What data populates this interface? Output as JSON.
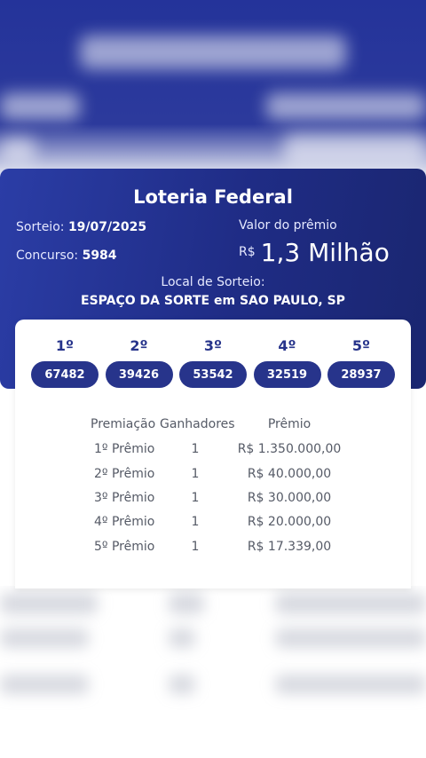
{
  "card": {
    "title": "Loteria Federal",
    "sorteio_label": "Sorteio:",
    "sorteio_date": "19/07/2025",
    "concurso_label": "Concurso:",
    "concurso_number": "5984",
    "prize_label": "Valor do prêmio",
    "prize_currency": "R$",
    "prize_amount": "1,3 Milhão",
    "local_label": "Local de Sorteio:",
    "local_value": "ESPAÇO DA SORTE em SAO PAULO, SP"
  },
  "results": [
    {
      "ordinal": "1º",
      "number": "67482"
    },
    {
      "ordinal": "2º",
      "number": "39426"
    },
    {
      "ordinal": "3º",
      "number": "53542"
    },
    {
      "ordinal": "4º",
      "number": "32519"
    },
    {
      "ordinal": "5º",
      "number": "28937"
    }
  ],
  "table": {
    "headers": [
      "Premiação",
      "Ganhadores",
      "Prêmio"
    ],
    "rows": [
      [
        "1º Prêmio",
        "1",
        "R$ 1.350.000,00"
      ],
      [
        "2º Prêmio",
        "1",
        "R$ 40.000,00"
      ],
      [
        "3º Prêmio",
        "1",
        "R$ 30.000,00"
      ],
      [
        "4º Prêmio",
        "1",
        "R$ 20.000,00"
      ],
      [
        "5º Prêmio",
        "1",
        "R$ 17.339,00"
      ]
    ]
  },
  "colors": {
    "brand_blue": "#27348b",
    "card_gradient_start": "#2b3da6",
    "card_gradient_end": "#1a2670"
  }
}
